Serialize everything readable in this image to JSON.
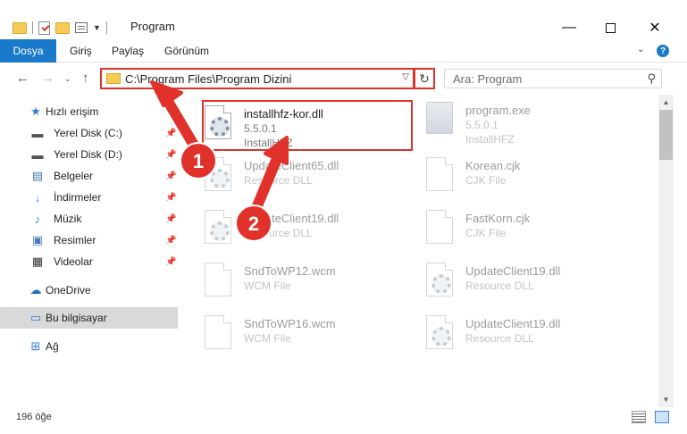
{
  "window": {
    "title": "Program",
    "minimize_glyph": "—",
    "close_glyph": "✕"
  },
  "ribbon": {
    "tabs": [
      "Dosya",
      "Giriş",
      "Paylaş",
      "Görünüm"
    ],
    "help_glyph": "?"
  },
  "nav": {
    "back_glyph": "←",
    "forward_glyph": "→",
    "recent_glyph": "⌄",
    "up_glyph": "↑",
    "address": "C:\\Program Files\\Program Dizini",
    "refresh_glyph": "↻",
    "search_placeholder": "Ara: Program"
  },
  "sidebar": {
    "items": [
      {
        "label": "Hızlı erişim",
        "icon": "star-icon",
        "pinned": false
      },
      {
        "label": "Yerel Disk (C:)",
        "icon": "drive-icon",
        "pinned": true
      },
      {
        "label": "Yerel Disk (D:)",
        "icon": "drive-icon",
        "pinned": true
      },
      {
        "label": "Belgeler",
        "icon": "documents-icon",
        "pinned": true
      },
      {
        "label": "İndirmeler",
        "icon": "download-icon",
        "pinned": true
      },
      {
        "label": "Müzik",
        "icon": "music-icon",
        "pinned": true
      },
      {
        "label": "Resimler",
        "icon": "pictures-icon",
        "pinned": true
      },
      {
        "label": "Videolar",
        "icon": "videos-icon",
        "pinned": true
      },
      {
        "label": "OneDrive",
        "icon": "onedrive-icon",
        "pinned": false
      },
      {
        "label": "Bu bilgisayar",
        "icon": "computer-icon",
        "pinned": false,
        "selected": true
      },
      {
        "label": "Ağ",
        "icon": "network-icon",
        "pinned": false
      }
    ]
  },
  "files": [
    {
      "name": "installhfz-kor.dll",
      "line2": "5.5.0.1",
      "line3": "InstallHFZ",
      "icon": "dll-gear-icon"
    },
    {
      "name": "program.exe",
      "line2": "5.5.0.1",
      "line3": "InstallHFZ",
      "icon": "exe-icon"
    },
    {
      "name": "UpdateClient65.dll",
      "line2": "Resource DLL",
      "icon": "dll-gear-icon"
    },
    {
      "name": "Korean.cjk",
      "line2": "CJK File",
      "icon": "file-icon"
    },
    {
      "name": "UpdateClient19.dll",
      "line2": "Resource DLL",
      "icon": "dll-gear-icon"
    },
    {
      "name": "FastKorn.cjk",
      "line2": "CJK File",
      "icon": "file-icon"
    },
    {
      "name": "SndToWP12.wcm",
      "line2": "WCM File",
      "icon": "file-icon"
    },
    {
      "name": "UpdateClient19.dll",
      "line2": "Resource DLL",
      "icon": "dll-gear-icon"
    },
    {
      "name": "SndToWP16.wcm",
      "line2": "WCM File",
      "icon": "file-icon"
    },
    {
      "name": "UpdateClient19.dll",
      "line2": "Resource DLL",
      "icon": "dll-gear-icon"
    }
  ],
  "annotations": {
    "badge1": "1",
    "badge2": "2",
    "color": "#e0322b"
  },
  "scrollbar": {
    "up_glyph": "▲",
    "down_glyph": "▼"
  },
  "status": {
    "item_count": "196 öğe"
  }
}
